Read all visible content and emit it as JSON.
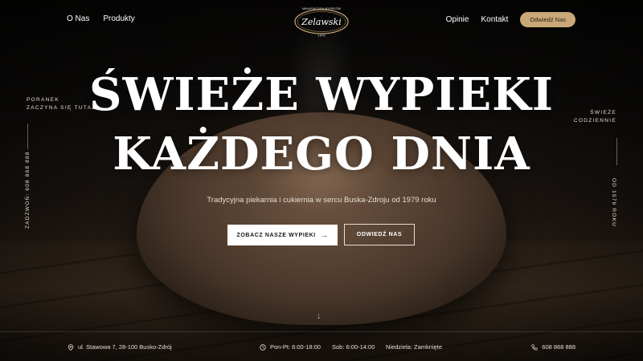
{
  "nav": {
    "left": [
      "O Nas",
      "Produkty"
    ],
    "right": [
      "Opinie",
      "Kontakt"
    ],
    "cta": "Odwiedź Nas"
  },
  "logo": {
    "top_text": "MANUFAKTURA WYPIEKÓW",
    "name": "Zelawski",
    "year": "1979"
  },
  "hero": {
    "headline_1": "ŚWIEŻE WYPIEKI",
    "headline_2": "KAŻDEGO DNIA",
    "subtitle": "Tradycyjna piekarnia i cukiernia w sercu Buska-Zdroju od 1979 roku",
    "primary_button": "ZOBACZ NASZE WYPIEKI",
    "primary_button_arrow": "→",
    "secondary_button": "ODWIEDŹ NAS",
    "scroll_icon": "↓"
  },
  "side": {
    "left_line1": "PORANEK",
    "left_line2": "ZACZYNA SIĘ TUTAJ",
    "left_vertical": "ZADZWOŃ: 608 868 888",
    "right_line1": "ŚWIEŻE",
    "right_line2": "CODZIENNIE",
    "right_vertical": "OD 1979 ROKU"
  },
  "footer": {
    "address": "ul. Stawowa 7, 28-100 Busko-Zdrój",
    "hours_weekday": "Pon-Pt: 6:00-18:00",
    "hours_saturday": "Sob: 6:00-14:00",
    "hours_sunday": "Niedziela: Zamknięte",
    "phone": "608 868 888"
  },
  "colors": {
    "accent": "#c9a878",
    "background": "#0d0b09",
    "text": "#ffffff"
  },
  "icons": [
    "location-pin-icon",
    "clock-icon",
    "phone-icon",
    "arrow-right-icon",
    "arrow-down-icon"
  ]
}
